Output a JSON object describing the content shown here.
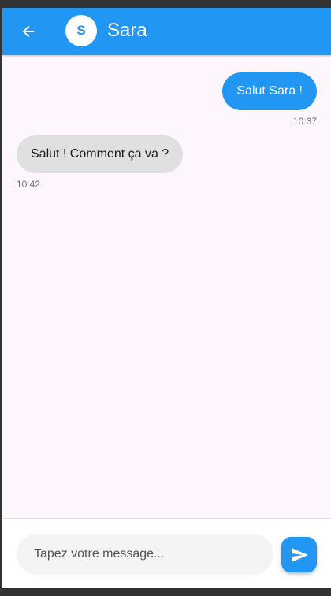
{
  "header": {
    "back_icon": "arrow-back-icon",
    "avatar_initial": "S",
    "contact_name": "Sara"
  },
  "messages": [
    {
      "direction": "outgoing",
      "text": "Salut Sara !",
      "time": "10:37"
    },
    {
      "direction": "incoming",
      "text": "Salut ! Comment ça va ?",
      "time": "10:42"
    }
  ],
  "composer": {
    "placeholder": "Tapez votre message...",
    "value": "",
    "send_icon": "send-icon"
  },
  "colors": {
    "accent": "#2196f3",
    "background": "#fdf7fd",
    "incoming_bubble": "#e0e0e0",
    "input_background": "#f4f4f4"
  }
}
